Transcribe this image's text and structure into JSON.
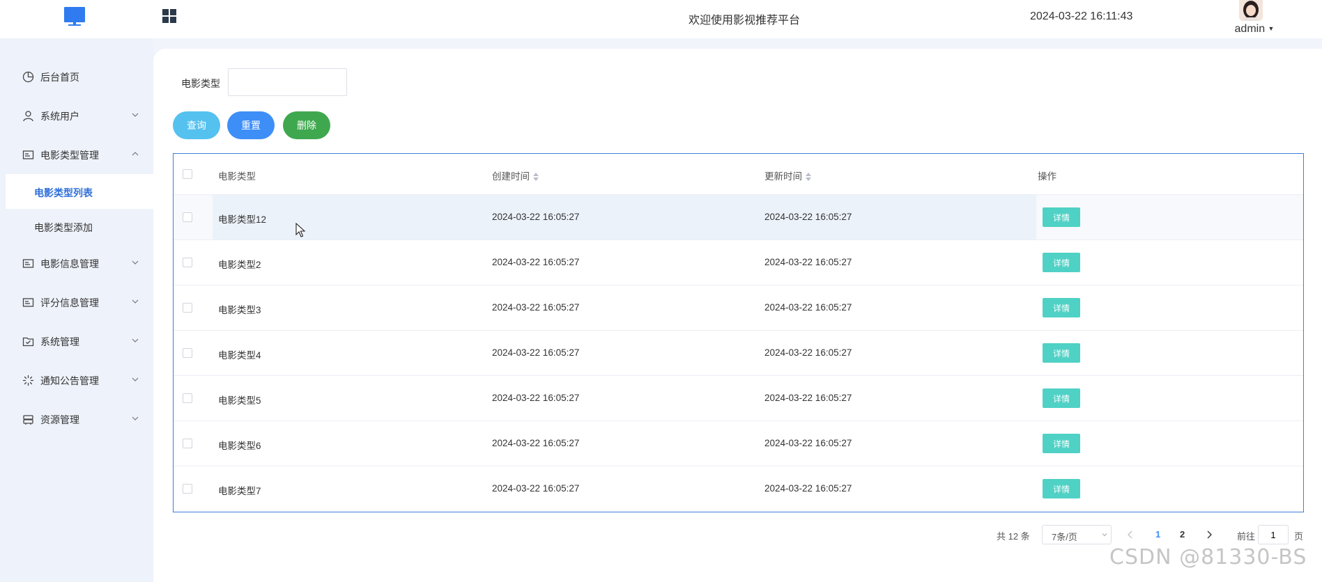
{
  "header": {
    "welcome": "欢迎使用影视推荐平台",
    "datetime": "2024-03-22 16:11:43",
    "username": "admin",
    "logo_icon": "monitor-icon",
    "menu_icon": "grid-icon"
  },
  "sidebar": {
    "items": [
      {
        "label": "后台首页",
        "icon": "pie-chart-icon"
      },
      {
        "label": "系统用户",
        "icon": "user-icon"
      },
      {
        "label": "电影类型管理",
        "icon": "card-icon"
      },
      {
        "label": "电影信息管理",
        "icon": "card-icon"
      },
      {
        "label": "评分信息管理",
        "icon": "card-icon"
      },
      {
        "label": "系统管理",
        "icon": "folder-check-icon"
      },
      {
        "label": "通知公告管理",
        "icon": "loading-icon"
      },
      {
        "label": "资源管理",
        "icon": "storage-icon"
      }
    ],
    "subitems": [
      {
        "label": "电影类型列表",
        "active": true
      },
      {
        "label": "电影类型添加",
        "active": false
      }
    ]
  },
  "filter": {
    "label": "电影类型",
    "value": ""
  },
  "buttons": {
    "query": "查询",
    "reset": "重置",
    "delete": "删除"
  },
  "table": {
    "columns": [
      "电影类型",
      "创建时间",
      "更新时间",
      "操作"
    ],
    "detail_label": "详情",
    "rows": [
      {
        "name": "电影类型12",
        "created": "2024-03-22 16:05:27",
        "updated": "2024-03-22 16:05:27"
      },
      {
        "name": "电影类型2",
        "created": "2024-03-22 16:05:27",
        "updated": "2024-03-22 16:05:27"
      },
      {
        "name": "电影类型3",
        "created": "2024-03-22 16:05:27",
        "updated": "2024-03-22 16:05:27"
      },
      {
        "name": "电影类型4",
        "created": "2024-03-22 16:05:27",
        "updated": "2024-03-22 16:05:27"
      },
      {
        "name": "电影类型5",
        "created": "2024-03-22 16:05:27",
        "updated": "2024-03-22 16:05:27"
      },
      {
        "name": "电影类型6",
        "created": "2024-03-22 16:05:27",
        "updated": "2024-03-22 16:05:27"
      },
      {
        "name": "电影类型7",
        "created": "2024-03-22 16:05:27",
        "updated": "2024-03-22 16:05:27"
      }
    ]
  },
  "pagination": {
    "total": "共 12 条",
    "page_size": "7条/页",
    "pages": [
      "1",
      "2"
    ],
    "current": "1",
    "goto_label": "前往",
    "goto_value": "1",
    "goto_suffix": "页"
  },
  "watermark": "CSDN @81330-BS",
  "colors": {
    "accent": "#3e8ef7",
    "query": "#55c1ef",
    "delete": "#3fa84f",
    "detail": "#4fd1c5"
  }
}
